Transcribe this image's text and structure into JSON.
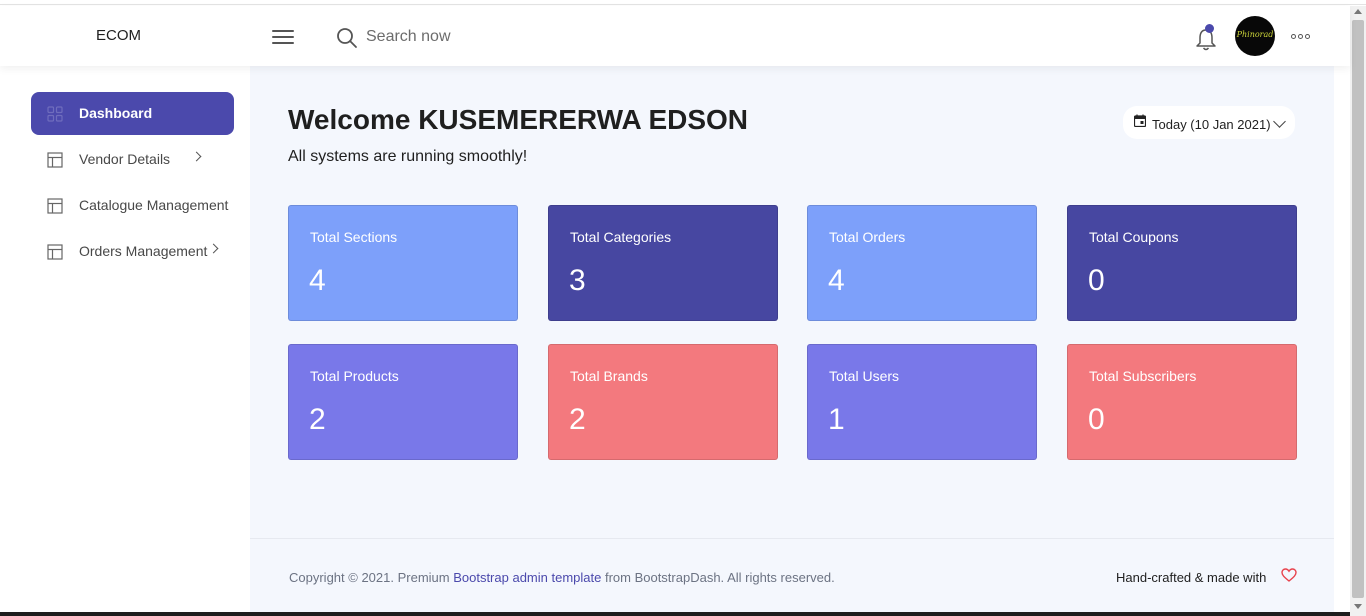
{
  "navbar": {
    "brand": "ECOM",
    "search_placeholder": "Search now",
    "avatar_text": "Phinorad"
  },
  "sidebar": {
    "items": [
      {
        "label": "Dashboard",
        "active": true,
        "icon": "grid-icon"
      },
      {
        "label": "Vendor Details",
        "active": false,
        "icon": "layout-icon",
        "has_arrow": true
      },
      {
        "label": "Catalogue Management",
        "active": false,
        "icon": "layout-icon"
      },
      {
        "label": "Orders Management",
        "active": false,
        "icon": "layout-icon",
        "has_arrow": true
      }
    ]
  },
  "main": {
    "welcome": "Welcome KUSEMERERWA EDSON",
    "subtitle": "All systems are running smoothly!",
    "date_label": "Today (10 Jan 2021)"
  },
  "cards": [
    {
      "title": "Total Sections",
      "value": "4",
      "color": "#7da0fa"
    },
    {
      "title": "Total Categories",
      "value": "3",
      "color": "#4747a1"
    },
    {
      "title": "Total Orders",
      "value": "4",
      "color": "#7da0fa"
    },
    {
      "title": "Total Coupons",
      "value": "0",
      "color": "#4747a1"
    },
    {
      "title": "Total Products",
      "value": "2",
      "color": "#7978e9"
    },
    {
      "title": "Total Brands",
      "value": "2",
      "color": "#f3797e"
    },
    {
      "title": "Total Users",
      "value": "1",
      "color": "#7978e9"
    },
    {
      "title": "Total Subscribers",
      "value": "0",
      "color": "#f3797e"
    }
  ],
  "footer": {
    "copyright_prefix": "Copyright © 2021. Premium ",
    "copyright_link": "Bootstrap admin template",
    "copyright_suffix": " from BootstrapDash. All rights reserved.",
    "handcrafted": "Hand-crafted & made with"
  },
  "colors": {
    "accent": "#4b49ac",
    "main_bg": "#f4f7fd",
    "heart": "#f3797e"
  }
}
